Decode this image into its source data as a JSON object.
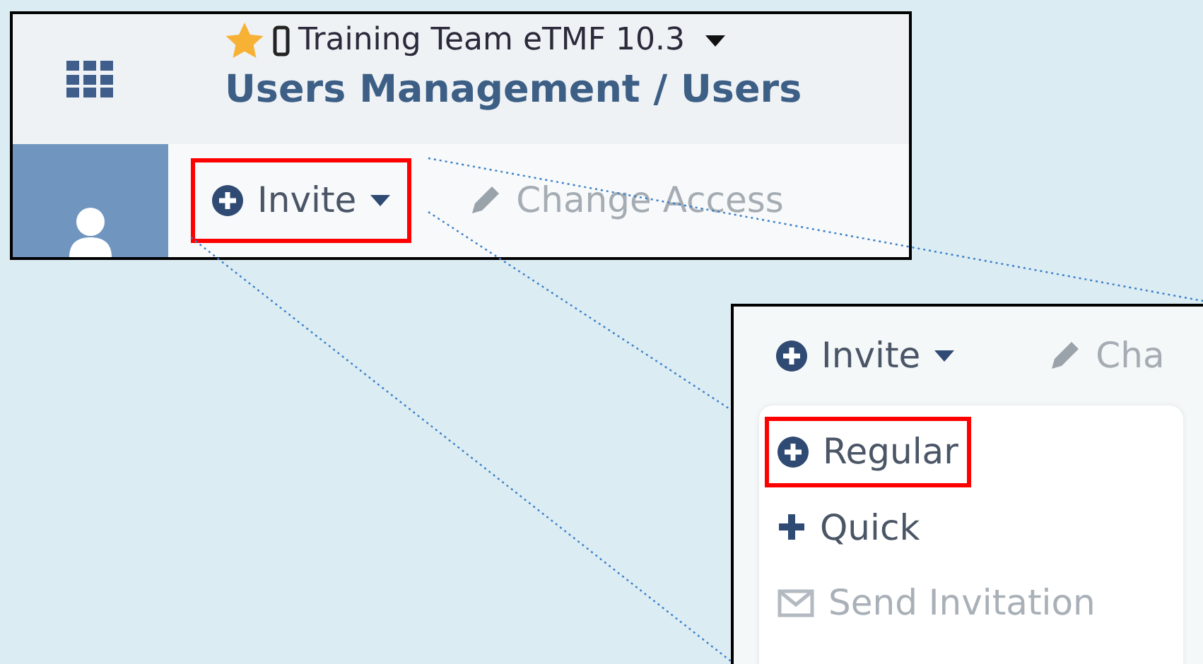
{
  "panel_1": {
    "project": "Training Team eTMF 10.3",
    "title": "Users Management / Users",
    "toolbar": [
      {
        "label": "Invite",
        "kind": "dropdown",
        "disabled": false,
        "highlighted": true
      },
      {
        "label": "Change Access",
        "kind": "edit",
        "disabled": true,
        "highlighted": false
      }
    ]
  },
  "panel_2": {
    "toolbar": [
      {
        "label": "Invite",
        "kind": "dropdown",
        "disabled": false,
        "highlighted": false
      },
      {
        "label": "Cha",
        "kind": "edit",
        "disabled": true,
        "highlighted": false
      }
    ],
    "menu": [
      {
        "label": "Regular",
        "kind": "plus-circle",
        "disabled": false,
        "highlighted": true
      },
      {
        "label": "Quick",
        "kind": "plus",
        "disabled": false,
        "highlighted": false
      },
      {
        "label": "Send Invitation",
        "kind": "envelope",
        "disabled": true,
        "highlighted": false
      }
    ]
  }
}
